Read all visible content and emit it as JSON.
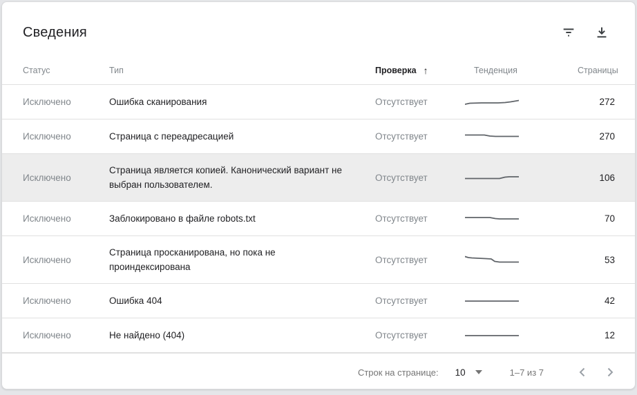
{
  "page": {
    "title": "Сведения"
  },
  "toolbar": {
    "filter_icon": "filter-list-icon",
    "download_icon": "download-icon"
  },
  "table": {
    "columns": [
      {
        "label": "Статус",
        "sorted": false
      },
      {
        "label": "Тип",
        "sorted": false
      },
      {
        "label": "Проверка",
        "sorted": true,
        "sort_direction": "up",
        "sort_arrow": "↑"
      },
      {
        "label": "Тенденция",
        "sorted": false
      },
      {
        "label": "Страницы",
        "sorted": false
      }
    ],
    "rows": [
      {
        "status": "Исключено",
        "type": "Ошибка сканирования",
        "validation": "Отсутствует",
        "pages": "272",
        "highlighted": false,
        "trend": [
          [
            0,
            10
          ],
          [
            7,
            8.5
          ],
          [
            24,
            8
          ],
          [
            48,
            8
          ],
          [
            58,
            7.5
          ],
          [
            66,
            6.5
          ],
          [
            78,
            4.5
          ]
        ]
      },
      {
        "status": "Исключено",
        "type": "Страница с переадресацией",
        "validation": "Отсутствует",
        "pages": "270",
        "highlighted": false,
        "trend": [
          [
            0,
            4.5
          ],
          [
            28,
            4.5
          ],
          [
            36,
            6
          ],
          [
            44,
            6.5
          ],
          [
            78,
            6.5
          ]
        ]
      },
      {
        "status": "Исключено",
        "type": "Страница является копией. Канонический вариант не выбран пользователем.",
        "validation": "Отсутствует",
        "pages": "106",
        "highlighted": true,
        "trend": [
          [
            0,
            8.5
          ],
          [
            50,
            8.5
          ],
          [
            58,
            6.5
          ],
          [
            64,
            6
          ],
          [
            78,
            6
          ]
        ]
      },
      {
        "status": "Исключено",
        "type": "Заблокировано в файле robots.txt",
        "validation": "Отсутствует",
        "pages": "70",
        "highlighted": false,
        "trend": [
          [
            0,
            5
          ],
          [
            36,
            5
          ],
          [
            44,
            6.5
          ],
          [
            50,
            7
          ],
          [
            78,
            7
          ]
        ]
      },
      {
        "status": "Исключено",
        "type": "Страница просканирована, но пока не проиндексирована",
        "validation": "Отсутствует",
        "pages": "53",
        "highlighted": false,
        "trend": [
          [
            0,
            2.5
          ],
          [
            5,
            4
          ],
          [
            10,
            4.5
          ],
          [
            30,
            5.5
          ],
          [
            38,
            6
          ],
          [
            43,
            9.5
          ],
          [
            50,
            10.5
          ],
          [
            78,
            10.5
          ]
        ]
      },
      {
        "status": "Исключено",
        "type": "Ошибка 404",
        "validation": "Отсутствует",
        "pages": "42",
        "highlighted": false,
        "trend": [
          [
            0,
            7
          ],
          [
            78,
            7
          ]
        ]
      },
      {
        "status": "Исключено",
        "type": "Не найдено (404)",
        "validation": "Отсутствует",
        "pages": "12",
        "highlighted": false,
        "trend": [
          [
            0,
            7
          ],
          [
            78,
            7
          ]
        ]
      }
    ]
  },
  "footer": {
    "rows_per_page_label": "Строк на странице:",
    "rows_per_page_value": "10",
    "range_label": "1–7 из 7",
    "prev_icon": "chevron-left-icon",
    "next_icon": "chevron-right-icon"
  },
  "colors": {
    "sparkline": "#5f6368",
    "icon_dark": "#3c4043",
    "pager_chevron": "#9aa0a6"
  }
}
